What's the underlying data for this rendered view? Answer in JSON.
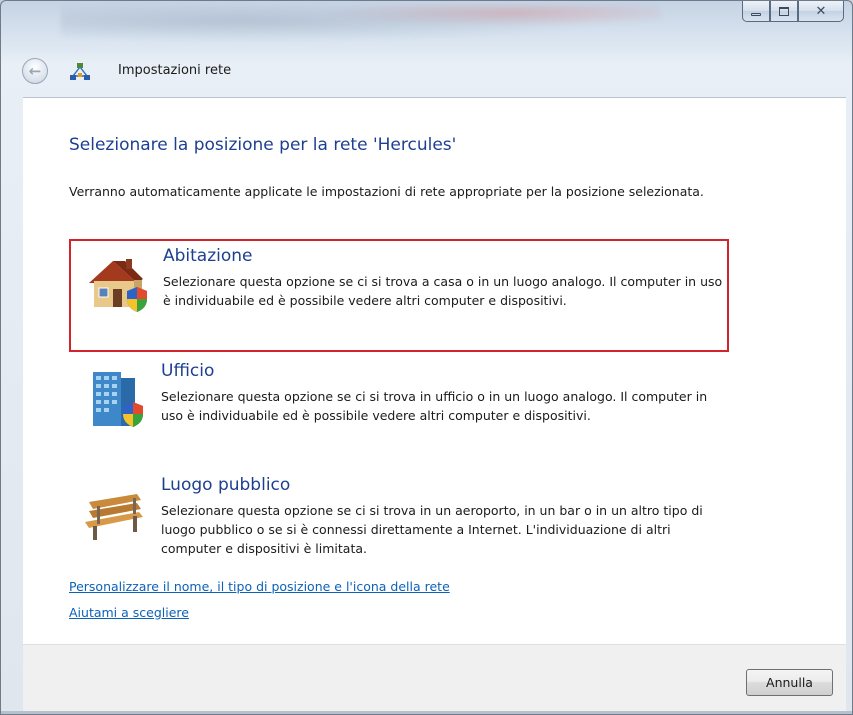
{
  "window": {
    "nav_title": "Impostazioni rete"
  },
  "page": {
    "title": "Selezionare la posizione per la rete 'Hercules'",
    "intro": "Verranno automaticamente applicate le impostazioni di rete appropriate per la posizione selezionata."
  },
  "options": [
    {
      "title": "Abitazione",
      "description": "Selezionare questa opzione se ci si trova a casa o in un luogo analogo. Il computer in uso è individuabile ed è possibile vedere altri computer e dispositivi.",
      "icon": "house-icon"
    },
    {
      "title": "Ufficio",
      "description": "Selezionare questa opzione se ci si trova in ufficio o in un luogo analogo. Il computer in uso è individuabile ed è possibile vedere altri computer e dispositivi.",
      "icon": "office-building-icon"
    },
    {
      "title": "Luogo pubblico",
      "description": "Selezionare questa opzione se ci si trova in un aeroporto, in un bar o in un altro tipo di luogo pubblico o se si è connessi direttamente a Internet. L'individuazione di altri computer e dispositivi è limitata.",
      "icon": "park-bench-icon"
    }
  ],
  "links": {
    "customize": "Personalizzare il nome, il tipo di posizione e l'icona della rete",
    "help": "Aiutami a scegliere"
  },
  "footer": {
    "cancel_label": "Annulla"
  },
  "colors": {
    "accent_title": "#1e3f91",
    "link": "#0b62b8",
    "selection_border": "#d3232b"
  }
}
